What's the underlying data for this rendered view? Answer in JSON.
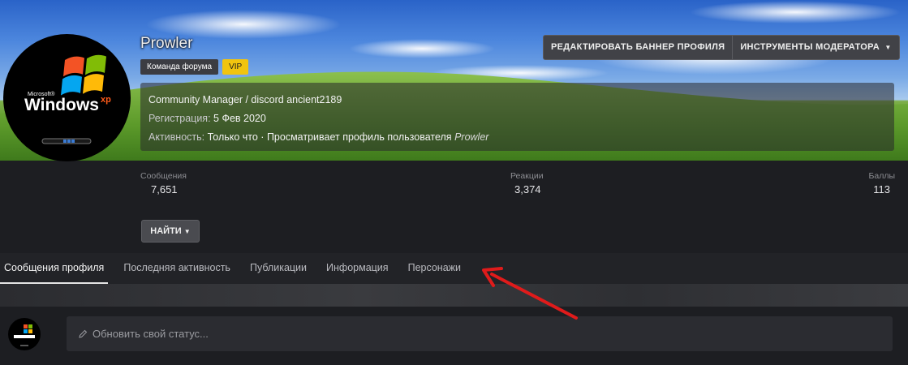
{
  "profile": {
    "username": "Prowler",
    "badges": [
      "Команда форума",
      "VIP"
    ],
    "custom_title": "Community Manager / discord ancient2189",
    "registration_label": "Регистрация:",
    "registration_value": "5 Фев 2020",
    "activity_label": "Активность:",
    "activity_value": "Только что · Просматривает профиль пользователя",
    "activity_user": "Prowler"
  },
  "avatar": {
    "brand_small": "Microsoft®",
    "brand": "Windows",
    "brand_suffix": "xp"
  },
  "buttons": {
    "edit_banner": "РЕДАКТИРОВАТЬ БАННЕР ПРОФИЛЯ",
    "moderator_tools": "ИНСТРУМЕНТЫ МОДЕРАТОРА",
    "find": "НАЙТИ"
  },
  "stats": {
    "messages": {
      "label": "Сообщения",
      "value": "7,651"
    },
    "reactions": {
      "label": "Реакции",
      "value": "3,374"
    },
    "points": {
      "label": "Баллы",
      "value": "113"
    }
  },
  "tabs": [
    {
      "label": "Сообщения профиля",
      "active": true
    },
    {
      "label": "Последняя активность",
      "active": false
    },
    {
      "label": "Публикации",
      "active": false
    },
    {
      "label": "Информация",
      "active": false
    },
    {
      "label": "Персонажи",
      "active": false
    }
  ],
  "status": {
    "placeholder": "Обновить свой статус..."
  },
  "icons": {
    "dropdown": "caret-down-icon",
    "edit": "pencil-icon",
    "annotation": "red-arrow-icon"
  },
  "colors": {
    "vip": "#f1c40f",
    "annotation": "#e01b1b",
    "background": "#1d1e22"
  }
}
